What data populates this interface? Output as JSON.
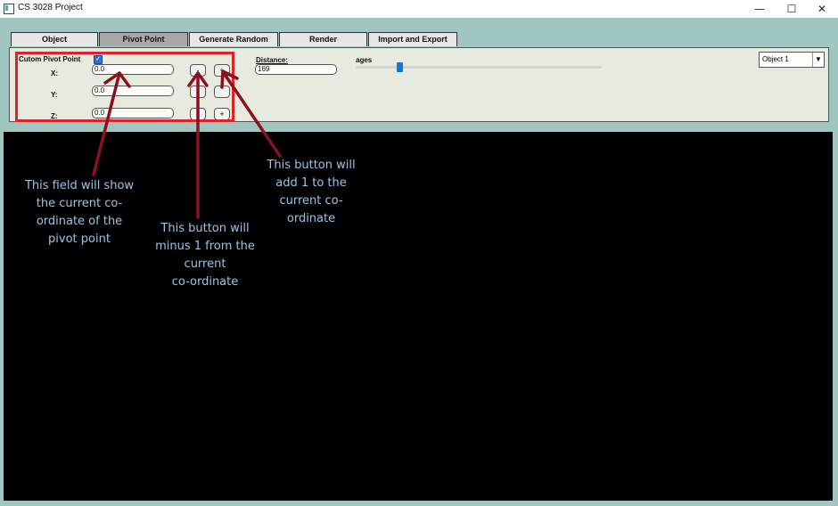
{
  "window": {
    "title": "CS 3028 Project",
    "minimize": "—",
    "maximize": "☐",
    "close": "✕"
  },
  "tabs": [
    {
      "label": "Object",
      "active": false
    },
    {
      "label": "Pivot Point",
      "active": true
    },
    {
      "label": "Generate Random",
      "active": false
    },
    {
      "label": "Render",
      "active": false
    },
    {
      "label": "Import and Export",
      "active": false
    }
  ],
  "pivot_panel": {
    "custom_label": "Cutom Pivot Point",
    "custom_checked": true,
    "x_label": "X:",
    "y_label": "Y:",
    "z_label": "Z:",
    "x_value": "0.0",
    "y_value": "0.0",
    "z_value": "0.0",
    "minus_label": "-",
    "plus_label": "+",
    "distance_label": "Distance:",
    "distance_value": "169",
    "ages_label": "ages",
    "object_select": "Object 1",
    "select_arrow": "▼"
  },
  "annotations": {
    "field_note": "This field will show\nthe current co-\nordinate of the\npivot point",
    "minus_note": "This button will\nminus 1 from the\ncurrent\nco-ordinate",
    "plus_note": "This button will\nadd 1 to the\ncurrent co-\nordinate"
  },
  "colors": {
    "annotation_box": "#e12228",
    "arrow": "#8b1020",
    "note_text": "#9dc3e6",
    "accent": "#1677d4"
  }
}
